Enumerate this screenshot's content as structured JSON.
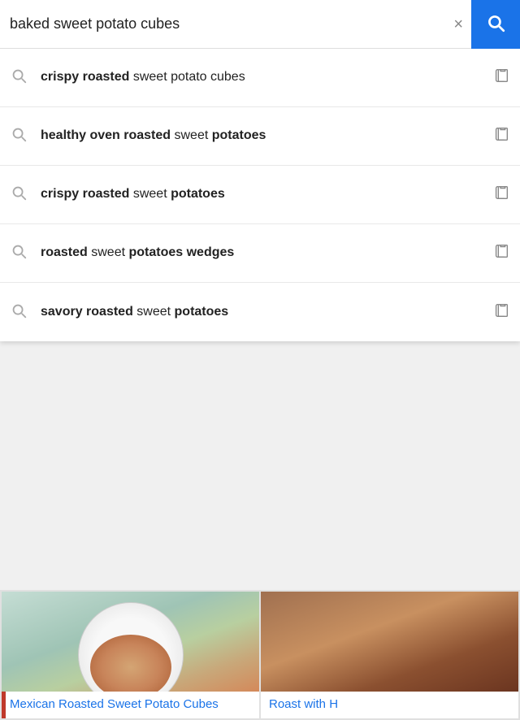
{
  "search": {
    "query": "baked sweet potato cubes",
    "clear_label": "×",
    "search_icon": "search-icon"
  },
  "suggestions": [
    {
      "id": 1,
      "bold_part": "crispy roasted",
      "normal_part": " sweet potato cubes"
    },
    {
      "id": 2,
      "bold_part": "healthy oven roasted",
      "normal_part": " sweet ",
      "bold_end": "potatoes"
    },
    {
      "id": 3,
      "bold_part": "crispy roasted",
      "normal_part": " sweet ",
      "bold_end": "potatoes"
    },
    {
      "id": 4,
      "bold_start": "roasted",
      "normal_part": " sweet ",
      "bold_end": "potatoes wedges"
    },
    {
      "id": 5,
      "bold_part": "savory roasted",
      "normal_part": " sweet ",
      "bold_end": "potatoes"
    }
  ],
  "results": {
    "left_card": {
      "title": "Mexican Roasted Sweet Potato Cubes"
    },
    "right_card": {
      "title": "Roast with H"
    }
  }
}
